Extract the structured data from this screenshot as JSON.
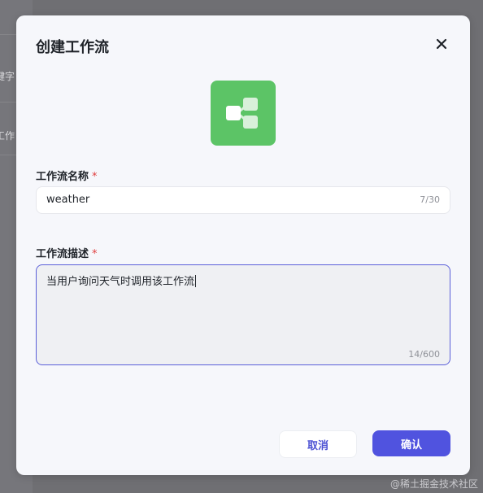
{
  "background": {
    "fragment_1": "键字",
    "fragment_2": "工作"
  },
  "dialog": {
    "title": "创建工作流",
    "close_icon": "close-icon",
    "logo_icon": "workflow-icon",
    "name_field": {
      "label": "工作流名称",
      "required_mark": "*",
      "value": "weather",
      "counter": "7/30"
    },
    "desc_field": {
      "label": "工作流描述",
      "required_mark": "*",
      "value": "当用户询问天气时调用该工作流",
      "counter": "14/600"
    },
    "buttons": {
      "cancel": "取消",
      "confirm": "确认"
    }
  },
  "watermark": "@稀土掘金技术社区",
  "colors": {
    "accent": "#5053df",
    "logo_bg": "#5cc466",
    "required": "#e03c3c"
  }
}
